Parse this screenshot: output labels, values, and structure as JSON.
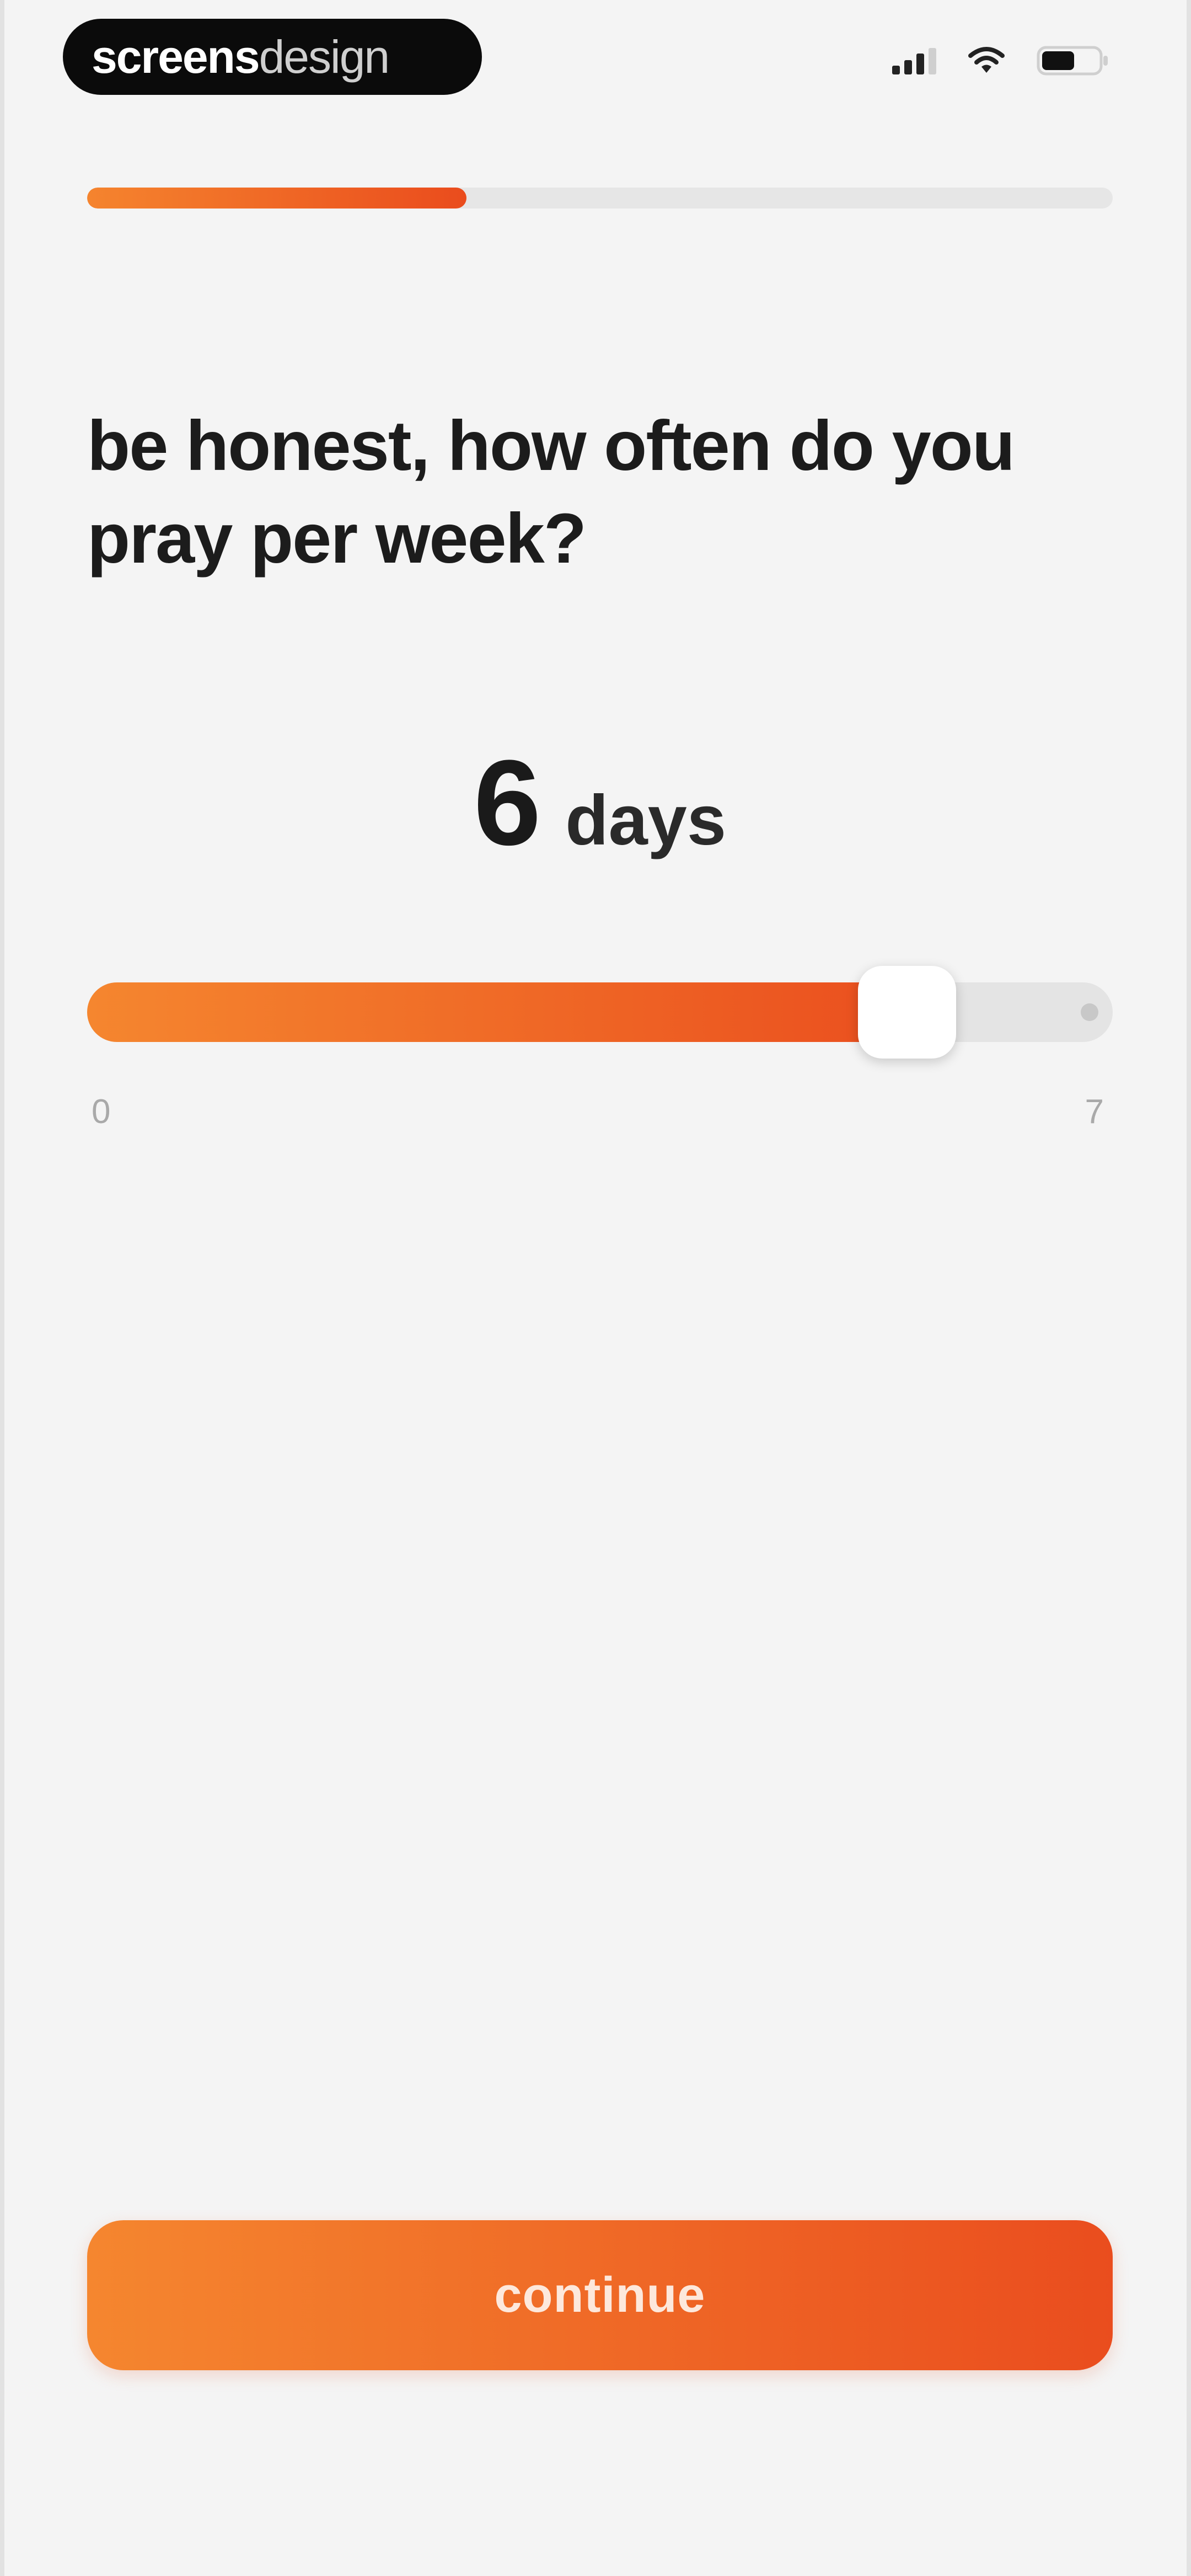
{
  "status_bar": {
    "brand_strong": "screens",
    "brand_light": "design",
    "icons": [
      "signal-icon",
      "wifi-icon",
      "battery-icon"
    ]
  },
  "progress": {
    "value": 0.37
  },
  "question": {
    "text": "be honest, how often do you pray per week?"
  },
  "slider": {
    "value": 6,
    "unit": "days",
    "min": 0,
    "max": 7,
    "min_label": "0",
    "max_label": "7"
  },
  "continue_button": {
    "label": "continue"
  },
  "colors": {
    "accent_start": "#f5862f",
    "accent_end": "#ea4d1e",
    "background": "#f4f4f4"
  }
}
